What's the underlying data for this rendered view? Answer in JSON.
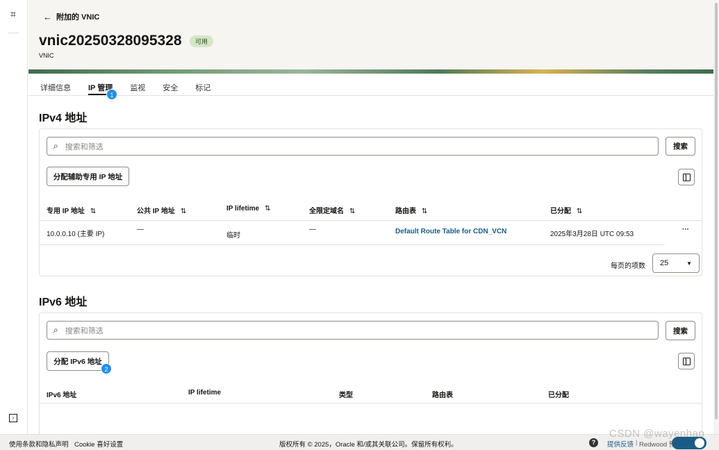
{
  "rail": {
    "top_icon": "chip-icon",
    "bottom_icon": "expand-panel-icon"
  },
  "header": {
    "back_label": "附加的 VNIC",
    "title": "vnic20250328095328",
    "status": "可用",
    "subtitle": "VNIC",
    "status_color": "#d4e7c5"
  },
  "tabs": [
    {
      "label": "详细信息"
    },
    {
      "label": "IP 管理",
      "active": true
    },
    {
      "label": "监视"
    },
    {
      "label": "安全"
    },
    {
      "label": "标记"
    }
  ],
  "markers": [
    "1",
    "2"
  ],
  "ipv4": {
    "title": "IPv4 地址",
    "search_placeholder": "搜索和筛选",
    "search_button": "搜索",
    "assign_button": "分配辅助专用 IP 地址",
    "columns": [
      "专用 IP 地址",
      "公共 IP 地址",
      "IP lifetime",
      "全限定域名",
      "路由表",
      "已分配"
    ],
    "rows": [
      {
        "private_ip": "10.0.0.10 (主要 IP)",
        "public_ip": "—",
        "lifetime": "临时",
        "fqdn": "—",
        "route_table": "Default Route Table for CDN_VCN",
        "assigned": "2025年3月28日 UTC 09:53",
        "actions": "···"
      }
    ],
    "per_page_label": "每页的项数",
    "per_page_value": "25"
  },
  "ipv6": {
    "title": "IPv6 地址",
    "search_placeholder": "搜索和筛选",
    "search_button": "搜索",
    "assign_button": "分配 IPv6 地址",
    "columns": [
      "IPv6 地址",
      "IP lifetime",
      "类型",
      "路由表",
      "已分配"
    ]
  },
  "footer": {
    "terms": "使用条款和隐私声明",
    "cookie": "Cookie 喜好设置",
    "copyright": "版权所有 © 2025，Oracle 和/或其关联公司。保留所有权利。",
    "feedback": "提供反馈",
    "separator": "|",
    "redwood": "Redwood 预览",
    "redwood_toggle_on": true
  },
  "watermark": "CSDN @wayenhap"
}
